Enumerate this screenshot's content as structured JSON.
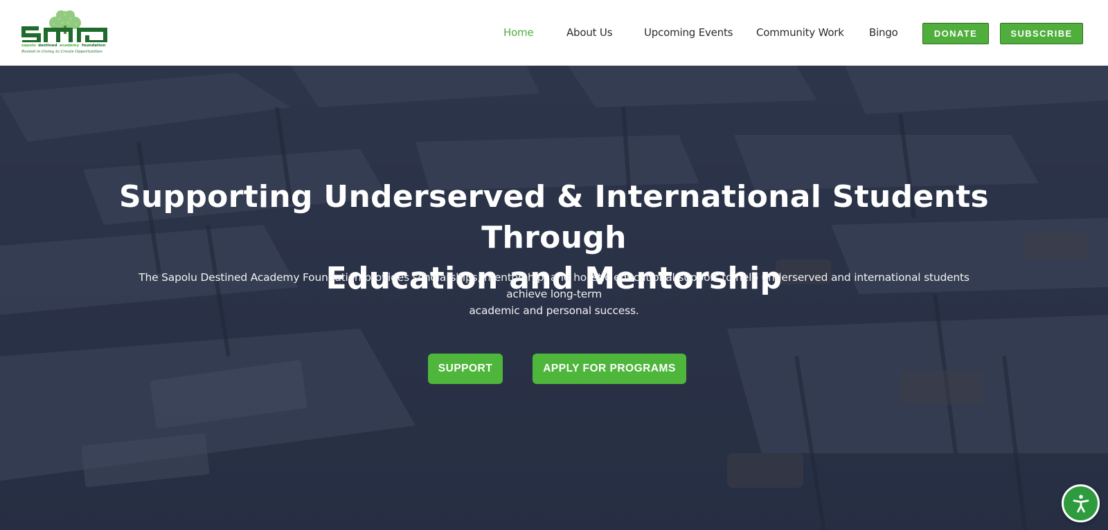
{
  "header": {
    "logo": {
      "mark": "SDA",
      "tagline": "Sapolu Destined Academy Foundation",
      "slogan": "Rooted in Giving to Create Opportunities"
    },
    "nav": [
      {
        "label": "Home",
        "active": true
      },
      {
        "label": "About Us",
        "active": false
      },
      {
        "label": "Upcoming Events",
        "active": false
      },
      {
        "label": "Community Work",
        "active": false
      },
      {
        "label": "Bingo",
        "active": false
      }
    ],
    "donate_label": "DONATE",
    "subscribe_label": "SUBSCRIBE"
  },
  "hero": {
    "title_line1": "Supporting Underserved & International Students Through",
    "title_line2": "Education and Mentorship",
    "subtitle_line1": "The Sapolu Destined Academy Foundation provides scholarships, mentorship, and holistic educational support to help underserved and international students achieve long-term",
    "subtitle_line2": "academic and personal success.",
    "support_label": "SUPPORT",
    "apply_label": "APPLY FOR PROGRAMS"
  },
  "accessibility": {
    "icon": "accessibility-icon"
  },
  "colors": {
    "brand_green": "#4fae3c",
    "hero_overlay": "#1c243a",
    "nav_text": "#2b2b2b"
  }
}
